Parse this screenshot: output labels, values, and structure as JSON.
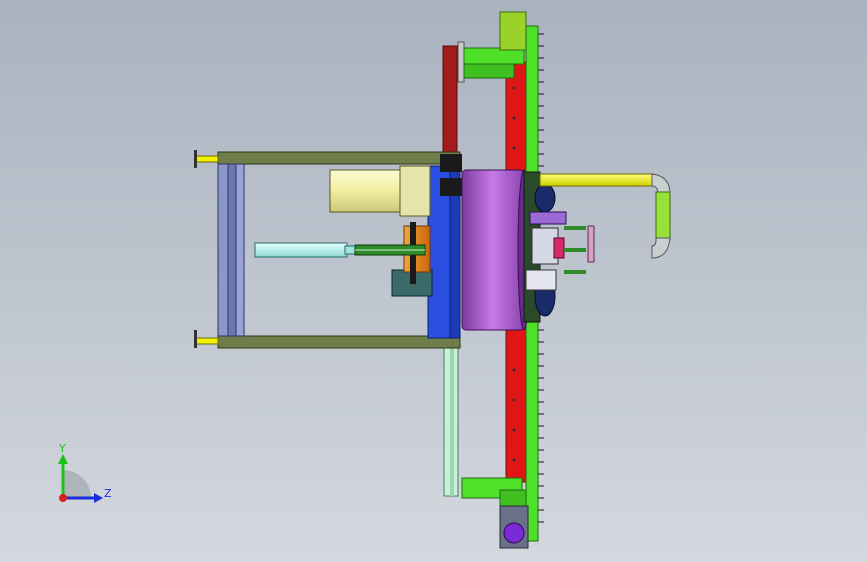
{
  "viewport": {
    "background_top": "#a9b2bf",
    "background_bottom": "#d4d8de"
  },
  "triad": {
    "y_label": "Y",
    "z_label": "Z",
    "y_color": "#19c419",
    "z_color": "#1a2ee0",
    "origin_color": "#d91c1c"
  },
  "model": {
    "icons": [
      "cad-assembly-view"
    ],
    "colors": {
      "frame": "#6f7d4a",
      "frame_dark": "#3f4a26",
      "yellow": "#f2f200",
      "green": "#4fe02a",
      "red": "#e01515",
      "purple": "#b25ad6",
      "blue": "#2b4fe0",
      "cyan": "#a9f2ee",
      "cream": "#f4f2b6",
      "orange": "#e88a1a",
      "slate": "#8a95c8"
    }
  }
}
